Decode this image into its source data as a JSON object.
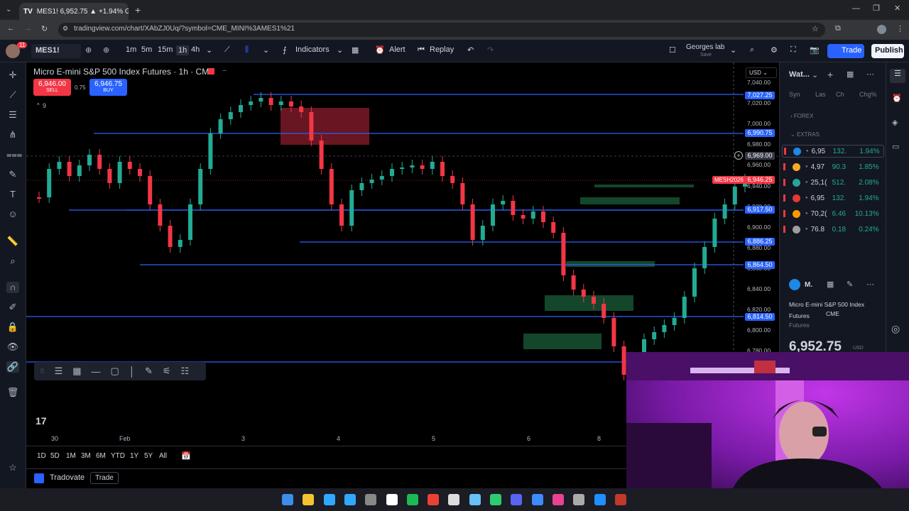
{
  "browser": {
    "tab_title": "MES1! 6,952.75 ▲ +1.94% Geo",
    "url": "tradingview.com/chart/XAbZJ0Uq/?symbol=CME_MINI%3AMES1%21"
  },
  "toolbar": {
    "symbol": "MES1!",
    "avatar_badge": "11",
    "timeframes": [
      "1m",
      "5m",
      "15m",
      "1h",
      "4h"
    ],
    "active_timeframe": "1h",
    "indicators": "Indicators",
    "alert": "Alert",
    "replay": "Replay",
    "layout_name": "Georges lab",
    "layout_sub": "Save",
    "trade": "Trade",
    "publish": "Publish"
  },
  "chart": {
    "title": "Micro E-mini S&P 500 Index Futures · 1h · CME",
    "sell_price": "6,946.00",
    "sell_label": "SELL",
    "spread": "0.75",
    "buy_price": "6,946.75",
    "buy_label": "BUY",
    "indicator_count": "9",
    "currency": "USD",
    "contract_label": "MESH2026",
    "axis_ticks": [
      "7,040.00",
      "7,020.00",
      "7,000.00",
      "6,980.00",
      "6,960.00",
      "6,940.00",
      "6,920.00",
      "6,900.00",
      "6,880.00",
      "6,860.00",
      "6,840.00",
      "6,820.00",
      "6,800.00",
      "6,780.00"
    ],
    "level_labels": [
      "7,027.25",
      "6,990.75",
      "6,969.00",
      "6,946.25",
      "6,917.50",
      "6,886.25",
      "6,864.50",
      "6,814.50"
    ],
    "date_labels": [
      "30",
      "Feb",
      "3",
      "4",
      "5",
      "6",
      "8"
    ],
    "ranges": [
      "1D",
      "5D",
      "1M",
      "3M",
      "6M",
      "YTD",
      "1Y",
      "5Y",
      "All"
    ],
    "broker": "Tradovate",
    "broker_action": "Trade"
  },
  "watchlist": {
    "title": "Wat...",
    "columns": [
      "Syn",
      "Las",
      "Ch",
      "Chg%"
    ],
    "sections": [
      "FOREX",
      "EXTRAS"
    ],
    "rows": [
      {
        "last": "6,95",
        "chg": "132.",
        "pct": "1.94%",
        "color": "#1e88e5"
      },
      {
        "last": "4,97",
        "chg": "90.3",
        "pct": "1.85%",
        "color": "#f9a825"
      },
      {
        "last": "25,1(",
        "chg": "512.",
        "pct": "2.08%",
        "color": "#26a69a"
      },
      {
        "last": "6,95",
        "chg": "132.",
        "pct": "1.94%",
        "color": "#e53935"
      },
      {
        "last": "70,2(",
        "chg": "6.46",
        "pct": "10.13%",
        "color": "#ff9800"
      },
      {
        "last": "76.8",
        "chg": "0.18",
        "pct": "0.24%",
        "color": "#9e9e9e"
      }
    ],
    "detail_symbol": "M.",
    "detail_name": "Micro E-mini S&P 500 Index Futures",
    "detail_exchange": "CME",
    "detail_type": "Futures",
    "detail_price": "6,952.75",
    "detail_currency": "USD"
  }
}
